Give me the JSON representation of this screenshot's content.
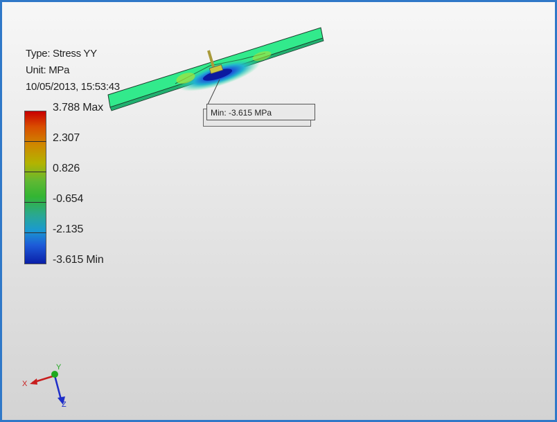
{
  "info": {
    "type_line": "Type: Stress YY",
    "unit_line": "Unit: MPa",
    "date_line": "10/05/2013, 15:53:43"
  },
  "legend": {
    "max_label": "3.788 Max",
    "ticks": [
      "2.307",
      "0.826",
      "-0.654",
      "-2.135"
    ],
    "min_label": "-3.615 Min"
  },
  "probe": {
    "label": "Min: -3.615 MPa"
  },
  "triad": {
    "x_label": "X",
    "y_label": "Y",
    "z_label": "Z",
    "x_color": "#c81e1e",
    "y_color": "#1fa81f",
    "z_color": "#1e2ec8"
  }
}
